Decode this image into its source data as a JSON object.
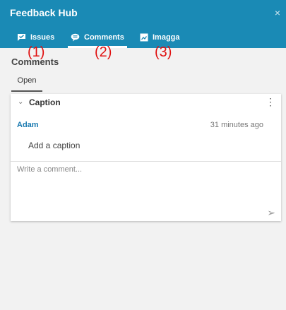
{
  "header": {
    "title": "Feedback Hub",
    "close_glyph": "×",
    "tabs": [
      {
        "label": "Issues",
        "icon": "flag-chat-icon"
      },
      {
        "label": "Comments",
        "icon": "speech-bubble-icon"
      },
      {
        "label": "Imagga",
        "icon": "image-tag-icon"
      }
    ]
  },
  "annotations": [
    "(1)",
    "(2)",
    "(3)"
  ],
  "section": {
    "title": "Comments",
    "subtab": "Open"
  },
  "card": {
    "title": "Caption",
    "author": "Adam",
    "time": "31 minutes ago",
    "caption_text": "Add a caption",
    "comment_placeholder": "Write a comment...",
    "more_glyph": "⋮",
    "chevron_glyph": "⌄",
    "send_glyph": "➢"
  },
  "colors": {
    "header_bg": "#1a8ab5",
    "author": "#1a7ab0",
    "annotation": "#e01010"
  }
}
